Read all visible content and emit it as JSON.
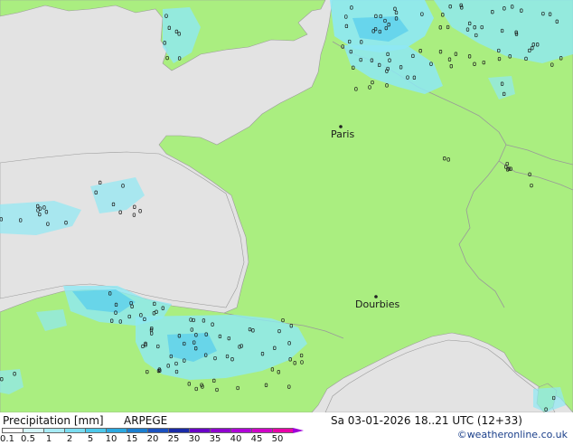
{
  "map": {
    "cities": [
      {
        "name": "Paris"
      },
      {
        "name": "Dourbies"
      }
    ],
    "colors": {
      "sea": "#e3e3e3",
      "land": "#aaee80",
      "border": "#999999",
      "precip_light": "#8ee8f4",
      "precip_mid": "#5cd0ec"
    }
  },
  "footer": {
    "legend_title": "Precipitation [mm]",
    "model": "ARPEGE",
    "valid_time": "Sa 03-01-2026 18..21 UTC (12+33)",
    "credit": "©weatheronline.co.uk"
  },
  "legend": {
    "labels": [
      "0.1",
      "0.5",
      "1",
      "2",
      "5",
      "10",
      "15",
      "20",
      "25",
      "30",
      "35",
      "40",
      "45",
      "50"
    ],
    "colors": [
      "#ffffff",
      "#d3f5fa",
      "#a7ebf5",
      "#7adcf0",
      "#4dc8ea",
      "#2aa8e0",
      "#1a7ed0",
      "#1a50c0",
      "#1a2aa8",
      "#6a00c8",
      "#9000d0",
      "#b000d8",
      "#d000c8",
      "#e800a8"
    ]
  }
}
